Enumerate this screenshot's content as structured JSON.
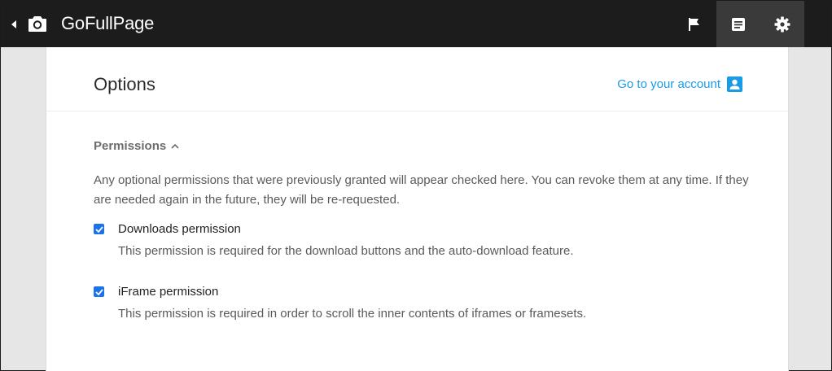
{
  "app": {
    "title": "GoFullPage"
  },
  "toolbar": {
    "back_icon": "caret-left-icon",
    "camera_icon": "camera-icon",
    "flag_icon": "flag-icon",
    "doc_icon": "document-icon",
    "gear_icon": "gear-icon"
  },
  "header": {
    "title": "Options",
    "account_link": "Go to your account",
    "account_icon": "account-box-icon"
  },
  "permissions": {
    "section_label": "Permissions",
    "description": "Any optional permissions that were previously granted will appear checked here. You can revoke them at any time. If they are needed again in the future, they will be re-requested.",
    "items": [
      {
        "label": "Downloads permission",
        "description": "This permission is required for the download buttons and the auto-download feature.",
        "checked": true
      },
      {
        "label": "iFrame permission",
        "description": "This permission is required in order to scroll the inner contents of iframes or framesets.",
        "checked": true
      }
    ]
  },
  "colors": {
    "topbar": "#1c1c1c",
    "accent": "#1a9be6",
    "checkbox": "#1a73e8"
  }
}
